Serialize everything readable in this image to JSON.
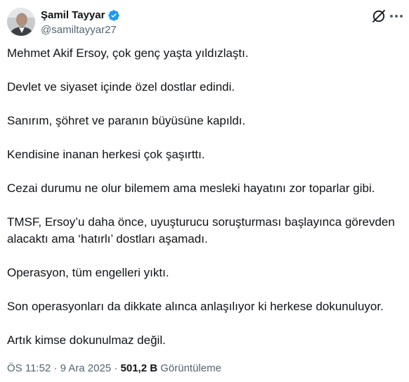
{
  "author": {
    "name": "Şamil Tayyar",
    "handle": "@samiltayyar27",
    "verified_icon": "verified-badge-icon",
    "avatar_icon": "profile-avatar"
  },
  "actions": {
    "grok_icon": "grok-icon",
    "more_icon": "more-options-icon"
  },
  "tweet": {
    "paragraphs": [
      "Mehmet Akif Ersoy, çok genç yaşta yıldızlaştı.",
      "Devlet ve siyaset içinde özel dostlar edindi.",
      "Sanırım, şöhret ve paranın büyüsüne kapıldı.",
      "Kendisine inanan herkesi çok şaşırttı.",
      "Cezai durumu ne olur bilemem ama mesleki hayatını zor toparlar gibi.",
      "TMSF, Ersoy’u daha önce, uyuşturucu soruşturması başlayınca görevden alacaktı ama ‘hatırlı’ dostları aşamadı.",
      "Operasyon, tüm engelleri yıktı.",
      "Son operasyonları da dikkate alınca anlaşılıyor ki herkese dokunuluyor.",
      "Artık kimse dokunulmaz değil."
    ]
  },
  "meta": {
    "time": "ÖS 11:52",
    "separator": "·",
    "date": "9 Ara 2025",
    "views_count": "501,2 B",
    "views_label": "Görüntüleme"
  },
  "colors": {
    "text": "#0f1419",
    "secondary": "#536471",
    "verified": "#1d9bf0"
  }
}
